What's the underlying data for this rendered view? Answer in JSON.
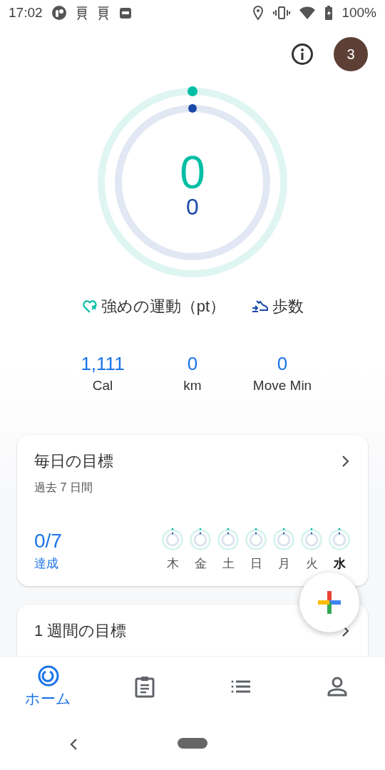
{
  "status_bar": {
    "time": "17:02",
    "battery": "100%"
  },
  "header": {
    "avatar": "3"
  },
  "rings": {
    "heart": {
      "value": "0",
      "level": 0
    },
    "steps": {
      "value": "0",
      "level": 0
    }
  },
  "legend": [
    {
      "kind": "heart",
      "label": "強めの運動（pt）"
    },
    {
      "kind": "steps",
      "label": "歩数"
    }
  ],
  "stats": [
    {
      "value": "1,111",
      "label": "Cal"
    },
    {
      "value": "0",
      "label": "km"
    },
    {
      "value": "0",
      "label": "Move Min"
    }
  ],
  "daily_goals": {
    "title": "毎日の目標",
    "subtitle": "過去 7 日間",
    "score": "0/7",
    "score_label": "達成",
    "days": [
      {
        "label": "木",
        "selected": false
      },
      {
        "label": "金",
        "selected": false
      },
      {
        "label": "土",
        "selected": false
      },
      {
        "label": "日",
        "selected": false
      },
      {
        "label": "月",
        "selected": false
      },
      {
        "label": "火",
        "selected": false
      },
      {
        "label": "水",
        "selected": true
      }
    ]
  },
  "weekly_goals": {
    "title": "1 週間の目標"
  },
  "nav_tabs": [
    {
      "kind": "home",
      "label": "ホーム",
      "selected": true
    },
    {
      "kind": "journal",
      "selected": false
    },
    {
      "kind": "browse",
      "selected": false
    },
    {
      "kind": "profile",
      "selected": false
    }
  ]
}
